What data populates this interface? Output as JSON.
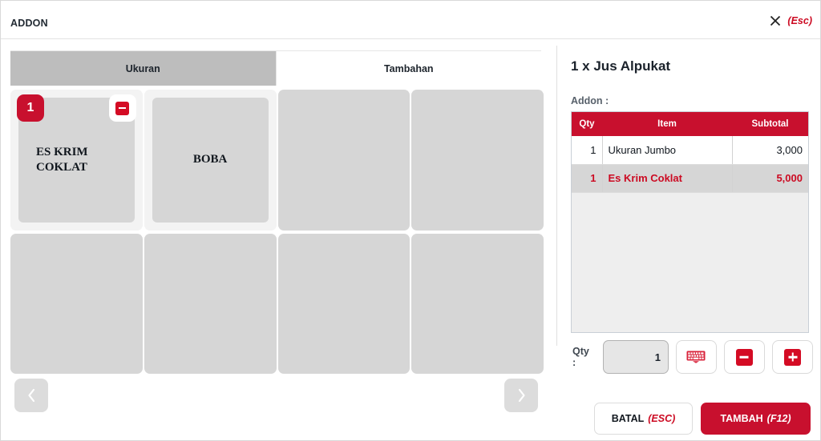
{
  "window": {
    "title": "ADDON",
    "close_icon": "close-x-icon",
    "close_key": "(Esc)"
  },
  "tabs": [
    {
      "label": "Ukuran",
      "active": true
    },
    {
      "label": "Tambahan",
      "active": false
    }
  ],
  "grid": {
    "tiles": [
      {
        "label": "ES KRIM COKLAT",
        "selected": true,
        "qty": "1",
        "minus_icon": "minus-icon"
      },
      {
        "label": "BOBA",
        "selected": false,
        "framed": true
      },
      {
        "label": "",
        "selected": false
      },
      {
        "label": "",
        "selected": false
      },
      {
        "label": "",
        "selected": false
      },
      {
        "label": "",
        "selected": false
      },
      {
        "label": "",
        "selected": false
      },
      {
        "label": "",
        "selected": false
      }
    ],
    "prev_icon": "chevron-left-icon",
    "next_icon": "chevron-right-icon"
  },
  "order": {
    "title": "1 x Jus Alpukat",
    "addon_label": "Addon :",
    "columns": [
      "Qty",
      "Item",
      "Subtotal"
    ],
    "rows": [
      {
        "qty": "1",
        "item": "Ukuran Jumbo",
        "subtotal": "3,000",
        "active": false
      },
      {
        "qty": "1",
        "item": "Es Krim Coklat",
        "subtotal": "5,000",
        "active": true
      }
    ]
  },
  "qty_controls": {
    "label": "Qty :",
    "value": "1",
    "keyboard_icon": "keyboard-icon",
    "minus_icon": "minus-icon",
    "plus_icon": "plus-icon"
  },
  "footer": {
    "cancel_label": "BATAL",
    "cancel_key": "(ESC)",
    "confirm_label": "TAMBAH",
    "confirm_key": "(F12)"
  },
  "colors": {
    "brand_red": "#C8102E",
    "accent_red": "#CC0A22",
    "tile_gray": "#D6D6D6"
  }
}
